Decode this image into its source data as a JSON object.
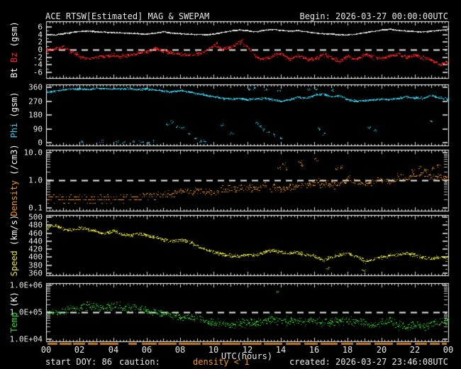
{
  "header": {
    "title": "ACE RTSW[Estimated] MAG & SWEPAM",
    "begin": "Begin: 2026-03-27 00:00:00UTC"
  },
  "footer": {
    "start_doy": "start DOY: 86",
    "caution": "caution:",
    "caution_value": "density < 1",
    "created": "created: 2026-03-27 23:46:08UTC"
  },
  "colors": {
    "background": "#000000",
    "text": "#e8e8e8",
    "bt": "#e8e8e8",
    "bz": "#ff2222",
    "phi": "#2fd0ee",
    "density": "#f09a18",
    "speed": "#e8e830",
    "temp": "#30d530",
    "caution_strip": "#bd7524",
    "dashed_line": "#e8e8e8"
  },
  "xaxis": {
    "label": "UTC(hours)",
    "range": [
      0,
      24
    ],
    "ticks": [
      "00",
      "02",
      "04",
      "06",
      "08",
      "10",
      "12",
      "14",
      "16",
      "18",
      "20",
      "22",
      "00"
    ]
  },
  "caution_segments": [
    [
      0.1,
      0.7
    ],
    [
      0.8,
      1.5
    ],
    [
      1.6,
      2.3
    ],
    [
      2.5,
      3.1
    ],
    [
      3.2,
      4.3
    ],
    [
      4.9,
      5.4
    ],
    [
      5.7,
      6.6
    ],
    [
      6.7,
      7.8
    ],
    [
      7.9,
      9.2
    ],
    [
      9.3,
      10.4
    ],
    [
      10.5,
      11.6
    ],
    [
      11.7,
      12.9
    ],
    [
      13.0,
      14.1
    ],
    [
      14.3,
      15.2
    ],
    [
      15.4,
      16.2
    ],
    [
      16.4,
      17.4
    ],
    [
      17.6,
      18.3
    ],
    [
      18.5,
      19.4
    ],
    [
      19.6,
      20.7
    ],
    [
      20.9,
      21.8
    ],
    [
      22.0,
      22.7
    ],
    [
      22.9,
      23.5
    ],
    [
      23.6,
      23.9
    ]
  ],
  "anchor_hours": [
    0,
    0.5,
    1,
    1.5,
    2,
    2.5,
    3,
    3.5,
    4,
    4.5,
    5,
    5.5,
    6,
    6.5,
    7,
    7.5,
    8,
    8.5,
    9,
    9.5,
    10,
    10.5,
    11,
    11.5,
    12,
    12.5,
    13,
    13.5,
    14,
    14.5,
    15,
    15.5,
    16,
    16.5,
    17,
    17.5,
    18,
    18.5,
    19,
    19.5,
    20,
    20.5,
    21,
    21.5,
    22,
    22.5,
    23,
    23.5,
    24
  ],
  "chart_data": [
    {
      "type": "scatter",
      "name": "bt-bz-panel",
      "ylabel_parts": [
        {
          "text": "Bt ",
          "color": "#ffffff"
        },
        {
          "text": "Bz",
          "color": "#ff2222"
        },
        {
          "text": " (gsm)",
          "color": "#ffffff"
        }
      ],
      "scale": "linear",
      "ylim": [
        -6,
        6
      ],
      "minor_step": 1,
      "dashed_at": 0,
      "yticks": [
        {
          "v": 6,
          "label": "6"
        },
        {
          "v": 4,
          "label": "4"
        },
        {
          "v": 2,
          "label": "2"
        },
        {
          "v": 0,
          "label": "0"
        },
        {
          "v": -2,
          "label": "-2"
        },
        {
          "v": -4,
          "label": "-4"
        },
        {
          "v": -6,
          "label": "-6"
        }
      ],
      "series": [
        {
          "name": "Bt",
          "color": "#e8e8e8",
          "jitter": 0.18,
          "drop": 0.08,
          "values": [
            4.1,
            4.0,
            4.3,
            4.6,
            4.9,
            5.0,
            4.8,
            4.7,
            4.6,
            4.5,
            4.4,
            4.3,
            4.2,
            4.5,
            4.8,
            4.4,
            4.3,
            4.2,
            4.1,
            4.0,
            4.2,
            4.6,
            5.0,
            5.3,
            5.1,
            4.8,
            5.2,
            5.5,
            5.2,
            5.0,
            5.1,
            4.8,
            4.5,
            4.3,
            4.2,
            4.0,
            4.0,
            4.2,
            4.6,
            4.9,
            5.3,
            5.5,
            5.2,
            5.0,
            4.9,
            4.8,
            5.0,
            5.2,
            5.5
          ],
          "outliers": []
        },
        {
          "name": "Bz",
          "color": "#ff2222",
          "jitter": 0.75,
          "drop": 0.25,
          "values": [
            0.0,
            0.3,
            0.8,
            -0.5,
            -1.8,
            -2.3,
            -2.0,
            -1.6,
            -1.5,
            -1.8,
            -1.4,
            -1.0,
            -0.3,
            0.3,
            -0.3,
            -0.8,
            -1.2,
            -1.4,
            -1.0,
            -0.6,
            1.2,
            0.2,
            0.8,
            2.0,
            0.8,
            -1.8,
            -2.4,
            -1.5,
            -1.0,
            -2.4,
            -1.6,
            -2.2,
            -2.5,
            -1.2,
            -2.0,
            -3.2,
            -1.6,
            -2.4,
            -1.2,
            -1.9,
            -2.4,
            -1.6,
            -1.0,
            -1.9,
            -1.5,
            -2.0,
            -2.8,
            -3.8,
            -3.0
          ],
          "outliers": [
            [
              10.1,
              1.8
            ],
            [
              11.6,
              2.3
            ],
            [
              11.7,
              2.6
            ]
          ]
        }
      ]
    },
    {
      "type": "scatter",
      "name": "phi-panel",
      "ylabel_parts": [
        {
          "text": "Phi",
          "color": "#2fd0ee"
        },
        {
          "text": " (gsm)",
          "color": "#ffffff"
        }
      ],
      "scale": "linear",
      "ylim": [
        0,
        360
      ],
      "minor_step": null,
      "dashed_at": null,
      "yticks": [
        {
          "v": 360,
          "label": "360"
        },
        {
          "v": 270,
          "label": "270"
        },
        {
          "v": 180,
          "label": "180"
        },
        {
          "v": 90,
          "label": "90"
        },
        {
          "v": 0,
          "label": "0"
        }
      ],
      "series": [
        {
          "name": "Phi",
          "color": "#2fd0ee",
          "jitter": 9,
          "drop": 0.3,
          "wrap": 360,
          "values": [
            330,
            335,
            345,
            350,
            352,
            348,
            352,
            355,
            350,
            353,
            350,
            346,
            350,
            344,
            338,
            330,
            340,
            332,
            320,
            310,
            300,
            292,
            286,
            290,
            282,
            286,
            290,
            280,
            272,
            280,
            298,
            290,
            310,
            318,
            300,
            308,
            282,
            272,
            276,
            280,
            284,
            282,
            290,
            298,
            294,
            290,
            308,
            292,
            282
          ],
          "outliers": [
            [
              2.1,
              5
            ],
            [
              3.3,
              8
            ],
            [
              4.2,
              8
            ],
            [
              4.6,
              4
            ],
            [
              5.2,
              10
            ],
            [
              5.7,
              6
            ],
            [
              6.1,
              3
            ],
            [
              6.4,
              12
            ],
            [
              7.2,
              120
            ],
            [
              7.5,
              140
            ],
            [
              7.8,
              100
            ],
            [
              8.1,
              95
            ],
            [
              8.5,
              60
            ],
            [
              8.9,
              30
            ],
            [
              9.2,
              10
            ],
            [
              9.5,
              8
            ],
            [
              10.5,
              120
            ],
            [
              11.0,
              60
            ],
            [
              12.6,
              130
            ],
            [
              12.8,
              110
            ],
            [
              13.0,
              90
            ],
            [
              13.3,
              70
            ],
            [
              13.6,
              50
            ],
            [
              14.0,
              30
            ],
            [
              16.3,
              90
            ],
            [
              16.6,
              60
            ],
            [
              19.3,
              100
            ],
            [
              19.6,
              80
            ],
            [
              23.0,
              140
            ],
            [
              12.1,
              352
            ],
            [
              12.4,
              356
            ],
            [
              13.1,
              348
            ],
            [
              13.9,
              342
            ],
            [
              15.6,
              350
            ],
            [
              16.1,
              352
            ],
            [
              17.1,
              344
            ]
          ]
        }
      ]
    },
    {
      "type": "scatter",
      "name": "density-panel",
      "ylabel_parts": [
        {
          "text": "Density",
          "color": "#f09a18"
        },
        {
          "text": " (/cm3)",
          "color": "#ffffff"
        }
      ],
      "scale": "log",
      "ylim": [
        0.1,
        10
      ],
      "minor_step": null,
      "dashed_at": 1.0,
      "yticks": [
        {
          "v": 10,
          "label": "10.0"
        },
        {
          "v": 1,
          "label": "1.0"
        },
        {
          "v": 0.1,
          "label": "0.1"
        }
      ],
      "series": [
        {
          "name": "Density",
          "color": "#f09a18",
          "jitter": 0.2,
          "drop": 0.5,
          "quantize": true,
          "values": [
            0.25,
            0.22,
            0.2,
            0.2,
            0.22,
            0.2,
            0.21,
            0.24,
            0.2,
            0.22,
            0.25,
            0.22,
            0.3,
            0.28,
            0.3,
            0.32,
            0.4,
            0.38,
            0.42,
            0.4,
            0.35,
            0.45,
            0.5,
            0.5,
            0.55,
            0.5,
            0.6,
            0.55,
            0.5,
            0.55,
            0.7,
            0.65,
            0.9,
            0.8,
            0.7,
            0.75,
            1.1,
            0.9,
            0.8,
            0.85,
            1.0,
            0.9,
            1.3,
            1.2,
            1.6,
            1.8,
            1.5,
            1.3,
            1.2
          ],
          "outliers": [
            [
              13.9,
              3
            ],
            [
              14.2,
              4
            ],
            [
              14.4,
              2.5
            ],
            [
              15.1,
              5
            ],
            [
              15.3,
              3.5
            ],
            [
              16.1,
              6
            ],
            [
              17.3,
              2.5
            ],
            [
              17.6,
              3
            ],
            [
              21.9,
              2.2
            ],
            [
              22.3,
              3
            ],
            [
              22.6,
              2.4
            ],
            [
              23.1,
              2.8
            ],
            [
              23.4,
              3.5
            ]
          ]
        }
      ]
    },
    {
      "type": "scatter",
      "name": "speed-panel",
      "ylabel_parts": [
        {
          "text": "Speed",
          "color": "#e8e830"
        },
        {
          "text": " (km/s)",
          "color": "#ffffff"
        }
      ],
      "scale": "linear",
      "ylim": [
        360,
        500
      ],
      "minor_step": 10,
      "dashed_at": null,
      "yticks": [
        {
          "v": 500,
          "label": "500"
        },
        {
          "v": 480,
          "label": "480"
        },
        {
          "v": 460,
          "label": "460"
        },
        {
          "v": 440,
          "label": "440"
        },
        {
          "v": 420,
          "label": "420"
        },
        {
          "v": 400,
          "label": "400"
        },
        {
          "v": 380,
          "label": "380"
        },
        {
          "v": 360,
          "label": "360"
        }
      ],
      "series": [
        {
          "name": "Speed",
          "color": "#e8e830",
          "jitter": 6,
          "drop": 0.35,
          "values": [
            475,
            480,
            472,
            468,
            474,
            470,
            465,
            460,
            467,
            458,
            455,
            460,
            455,
            450,
            445,
            440,
            444,
            438,
            428,
            420,
            414,
            408,
            404,
            402,
            407,
            404,
            414,
            417,
            414,
            410,
            412,
            408,
            404,
            394,
            400,
            407,
            410,
            404,
            390,
            394,
            400,
            404,
            408,
            410,
            405,
            400,
            397,
            401,
            400
          ],
          "outliers": [
            [
              16.8,
              372
            ],
            [
              19.0,
              368
            ]
          ]
        }
      ]
    },
    {
      "type": "scatter",
      "name": "temp-panel",
      "ylabel_parts": [
        {
          "text": "Temp",
          "color": "#30d530"
        },
        {
          "text": " (K)",
          "color": "#ffffff"
        }
      ],
      "scale": "log",
      "ylim": [
        10000,
        1000000
      ],
      "minor_step": null,
      "dashed_at": 100000,
      "yticks": [
        {
          "v": 1000000,
          "label": "1.0E+06"
        },
        {
          "v": 100000,
          "label": "1.0E+05"
        },
        {
          "v": 10000,
          "label": "1.0E+04"
        }
      ],
      "series": [
        {
          "name": "Temp",
          "color": "#30d530",
          "jitter": 0.22,
          "drop": 0.35,
          "values": [
            80000,
            100000,
            120000,
            130000,
            150000,
            170000,
            160000,
            150000,
            180000,
            160000,
            150000,
            140000,
            120000,
            100000,
            90000,
            80000,
            70000,
            60000,
            65000,
            50000,
            45000,
            40000,
            35000,
            40000,
            45000,
            40000,
            50000,
            55000,
            50000,
            45000,
            50000,
            45000,
            50000,
            40000,
            45000,
            50000,
            50000,
            45000,
            40000,
            35000,
            40000,
            45000,
            35000,
            30000,
            35000,
            30000,
            40000,
            45000,
            50000
          ],
          "outliers": [
            [
              13.8,
              600000
            ]
          ]
        }
      ]
    }
  ]
}
